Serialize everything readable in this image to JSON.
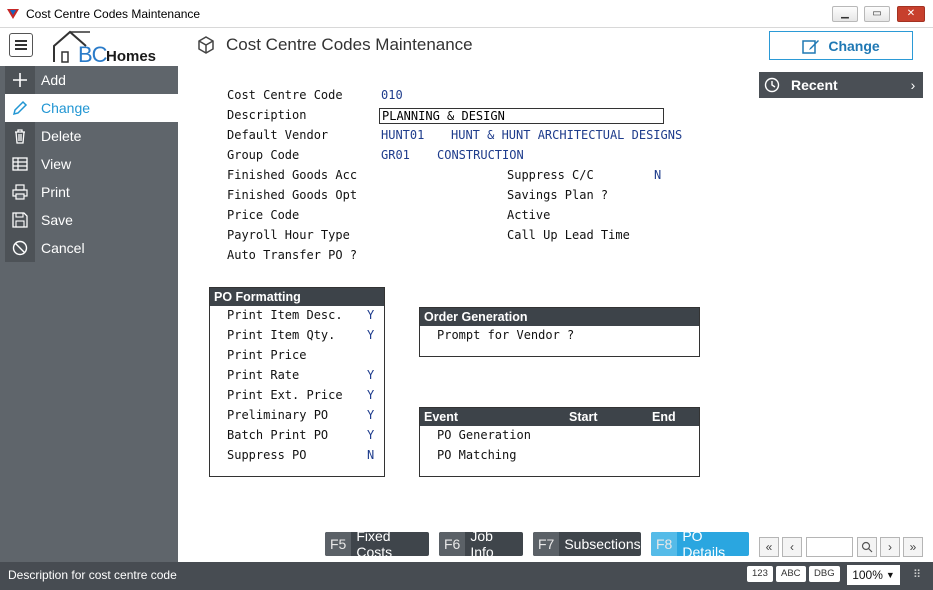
{
  "window": {
    "title": "Cost Centre Codes Maintenance"
  },
  "header": {
    "logo_bc": "BC",
    "logo_homes": "Homes",
    "title": "Cost Centre Codes Maintenance",
    "change_label": "Change"
  },
  "sidebar": {
    "items": [
      {
        "label": "Add",
        "icon": "plus-icon"
      },
      {
        "label": "Change",
        "icon": "pencil-icon"
      },
      {
        "label": "Delete",
        "icon": "trash-icon"
      },
      {
        "label": "View",
        "icon": "table-icon"
      },
      {
        "label": "Print",
        "icon": "printer-icon"
      },
      {
        "label": "Save",
        "icon": "floppy-icon"
      },
      {
        "label": "Cancel",
        "icon": "cancel-icon"
      }
    ]
  },
  "recent": {
    "label": "Recent"
  },
  "form": {
    "cost_centre_code": {
      "label": "Cost Centre Code",
      "value": "010"
    },
    "description": {
      "label": "Description",
      "value": "PLANNING & DESIGN"
    },
    "default_vendor": {
      "label": "Default Vendor",
      "code": "HUNT01",
      "name": "HUNT & HUNT ARCHITECTUAL DESIGNS"
    },
    "group_code": {
      "label": "Group Code",
      "code": "GR01",
      "name": "CONSTRUCTION"
    },
    "finished_goods_acc": {
      "label": "Finished Goods Acc"
    },
    "finished_goods_opt": {
      "label": "Finished Goods Opt"
    },
    "price_code": {
      "label": "Price Code"
    },
    "payroll_hour_type": {
      "label": "Payroll Hour Type"
    },
    "auto_transfer_po": {
      "label": "Auto Transfer PO ?"
    },
    "suppress_cc": {
      "label": "Suppress C/C",
      "value": "N"
    },
    "savings_plan": {
      "label": "Savings Plan ?"
    },
    "active": {
      "label": "Active"
    },
    "call_up_lead_time": {
      "label": "Call Up Lead Time"
    }
  },
  "po_formatting": {
    "title": "PO Formatting",
    "rows": [
      {
        "label": "Print Item Desc.",
        "value": "Y"
      },
      {
        "label": "Print Item Qty.",
        "value": "Y"
      },
      {
        "label": "Print Price",
        "value": ""
      },
      {
        "label": "Print Rate",
        "value": "Y"
      },
      {
        "label": "Print Ext. Price",
        "value": "Y"
      },
      {
        "label": "Preliminary PO",
        "value": "Y"
      },
      {
        "label": "Batch Print PO",
        "value": "Y"
      },
      {
        "label": "Suppress PO",
        "value": "N"
      }
    ]
  },
  "order_generation": {
    "title": "Order Generation",
    "prompt_label": "Prompt for Vendor ?"
  },
  "events": {
    "col_event": "Event",
    "col_start": "Start",
    "col_end": "End",
    "rows": [
      {
        "event": "PO Generation"
      },
      {
        "event": "PO Matching"
      }
    ]
  },
  "fkeys": [
    {
      "key": "F5",
      "label": "Fixed Costs"
    },
    {
      "key": "F6",
      "label": "Job Info"
    },
    {
      "key": "F7",
      "label": "Subsections"
    },
    {
      "key": "F8",
      "label": "PO Details"
    }
  ],
  "status": {
    "text": "Description for cost centre code",
    "badge_123": "123",
    "badge_abc": "ABC",
    "badge_dbg": "DBG",
    "zoom": "100%"
  },
  "colors": {
    "accent": "#2196d3",
    "sidebar": "#5f656b",
    "value_text": "#1e3c8c",
    "dark_header": "#3d4349"
  }
}
